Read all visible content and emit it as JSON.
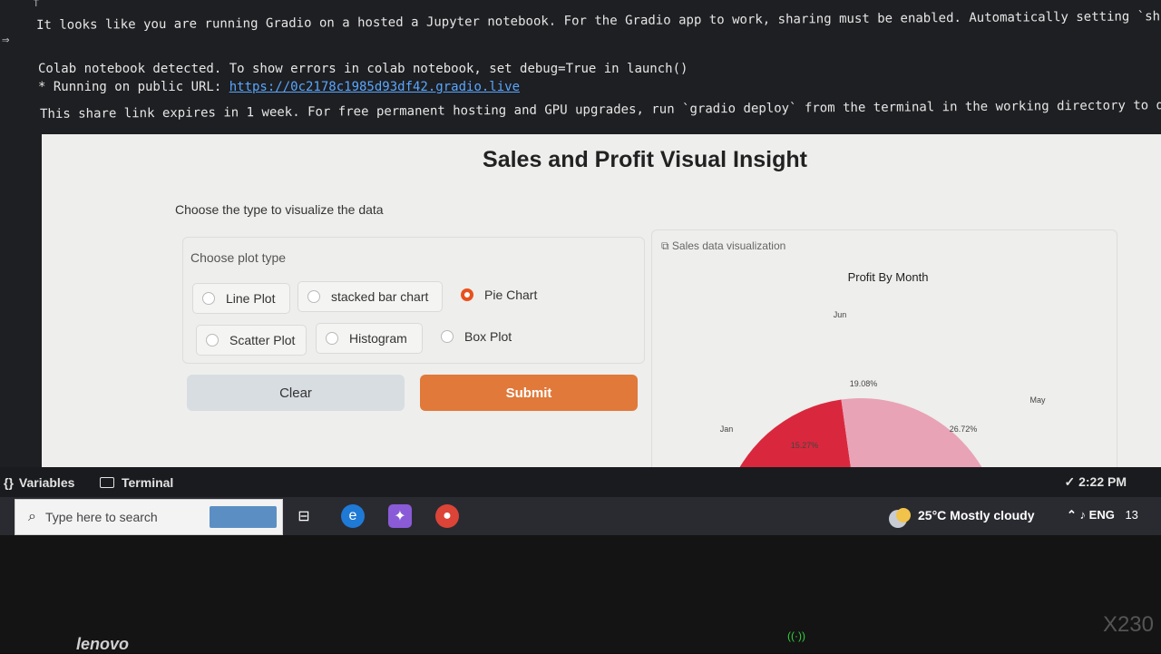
{
  "colab": {
    "top_glyph": "f",
    "output_icon": "⇒",
    "lines": {
      "share_warning": "It looks like you are running Gradio on a hosted a Jupyter notebook. For the Gradio app to work, sharing must be enabled. Automatically setting `sh",
      "debug_notice": "Colab notebook detected. To show errors in colab notebook, set debug=True in launch()",
      "running_prefix": "* Running on public URL: ",
      "public_url": "https://0c2178c1985d93df42.gradio.live",
      "expiry_notice": "This share link expires in 1 week. For free permanent hosting and GPU upgrades, run `gradio deploy` from the terminal in the working directory to d"
    }
  },
  "app": {
    "title": "Sales and Profit Visual Insight",
    "subtitle": "Choose the type to visualize the data",
    "radio": {
      "label": "Choose plot type",
      "options": [
        "Line Plot",
        "stacked bar chart",
        "Pie Chart",
        "Scatter Plot",
        "Histogram",
        "Box Plot"
      ],
      "selected": "Pie Chart"
    },
    "buttons": {
      "clear": "Clear",
      "submit": "Submit"
    },
    "plot": {
      "label": "Sales data visualization"
    }
  },
  "chart_data": {
    "type": "pie",
    "title": "Profit By Month",
    "categories": [
      "Jun",
      "May",
      "Jan"
    ],
    "values": [
      19.08,
      26.72,
      15.27
    ],
    "value_labels": [
      "19.08%",
      "26.72%",
      "15.27%"
    ],
    "colors": [
      "#d9283d",
      "#e8a3b6",
      "#a8cbe3"
    ],
    "partially_visible": true
  },
  "statusbar": {
    "variables": "Variables",
    "terminal": "Terminal",
    "time": "2:22 PM"
  },
  "taskbar": {
    "search_placeholder": "Type here to search",
    "weather_temp": "25°C",
    "weather_text": "Mostly cloudy",
    "language": "ENG",
    "clock_partial": "13"
  },
  "device": {
    "brand": "lenovo",
    "model": "X230"
  }
}
